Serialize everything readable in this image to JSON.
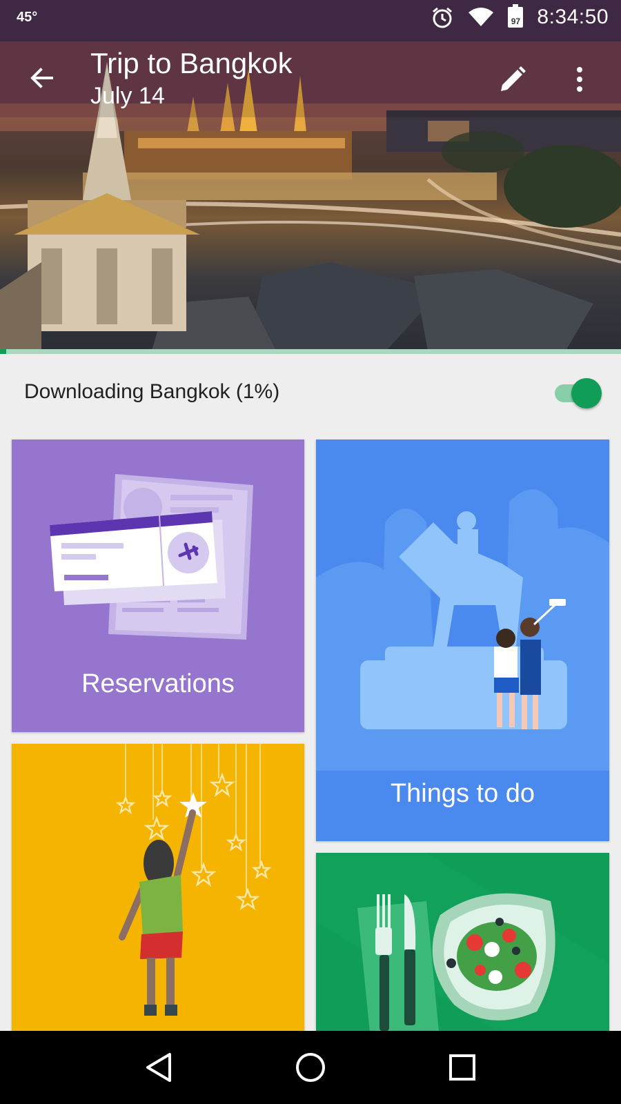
{
  "status_bar": {
    "temperature": "45°",
    "battery_level": "97",
    "time": "8:34:50",
    "icons": [
      "alarm-icon",
      "wifi-icon",
      "battery-icon"
    ]
  },
  "toolbar": {
    "title": "Trip to Bangkok",
    "date": "July 14",
    "icons": [
      "back-arrow-icon",
      "edit-pencil-icon",
      "more-vert-icon"
    ]
  },
  "download": {
    "label": "Downloading Bangkok (1%)",
    "progress_percent": 1,
    "toggle_on": true
  },
  "cards": {
    "reservations": {
      "label": "Reservations",
      "color": "#9575cd"
    },
    "things_to_do": {
      "label": "Things to do",
      "color": "#4a89ee"
    },
    "saved_places": {
      "color": "#f4b400"
    },
    "food_and_drink": {
      "color": "#0f9d58"
    }
  },
  "colors": {
    "accent": "#0f9d58"
  },
  "nav_bar": {
    "icons": [
      "back-triangle-icon",
      "home-circle-icon",
      "recents-square-icon"
    ]
  }
}
